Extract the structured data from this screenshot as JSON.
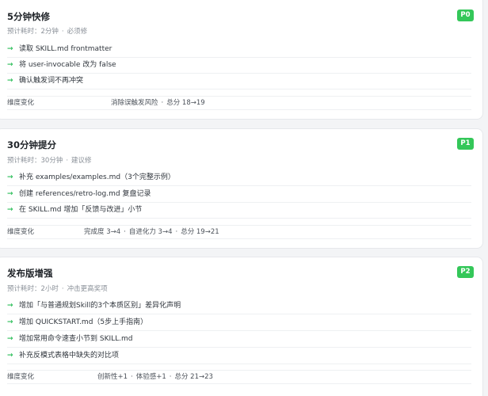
{
  "sections": [
    {
      "title": "5分钟快修",
      "badge": "P0",
      "meta_time": "预计耗时：2分钟",
      "meta_tag": "必须修",
      "tasks": [
        "读取 SKILL.md frontmatter",
        "将 user-invocable 改为 false",
        "确认触发词不再冲突"
      ],
      "dimension_label": "维度变化",
      "dimension_items": [
        "消除误触发风险",
        "总分 18→19"
      ]
    },
    {
      "title": "30分钟提分",
      "badge": "P1",
      "meta_time": "预计耗时：30分钟",
      "meta_tag": "建议修",
      "tasks": [
        "补充 examples/examples.md（3个完整示例）",
        "创建 references/retro-log.md 复盘记录",
        "在 SKILL.md 增加「反馈与改进」小节"
      ],
      "dimension_label": "维度变化",
      "dimension_items": [
        "完成度 3→4",
        "自进化力 3→4",
        "总分 19→21"
      ]
    },
    {
      "title": "发布版增强",
      "badge": "P2",
      "meta_time": "预计耗时：2小时",
      "meta_tag": "冲击更高奖项",
      "tasks": [
        "增加「与普通规划Skill的3个本质区别」差异化声明",
        "增加 QUICKSTART.md（5步上手指南）",
        "增加常用命令速查小节到 SKILL.md",
        "补充反模式表格中缺失的对比项"
      ],
      "dimension_label": "维度变化",
      "dimension_items": [
        "创新性+1",
        "体验感+1",
        "总分 21→23"
      ]
    }
  ],
  "icons": {
    "task_bullet": "arrow-right-icon"
  },
  "colors": {
    "badge": "#34c759",
    "arrow": "#2fbf5b"
  }
}
